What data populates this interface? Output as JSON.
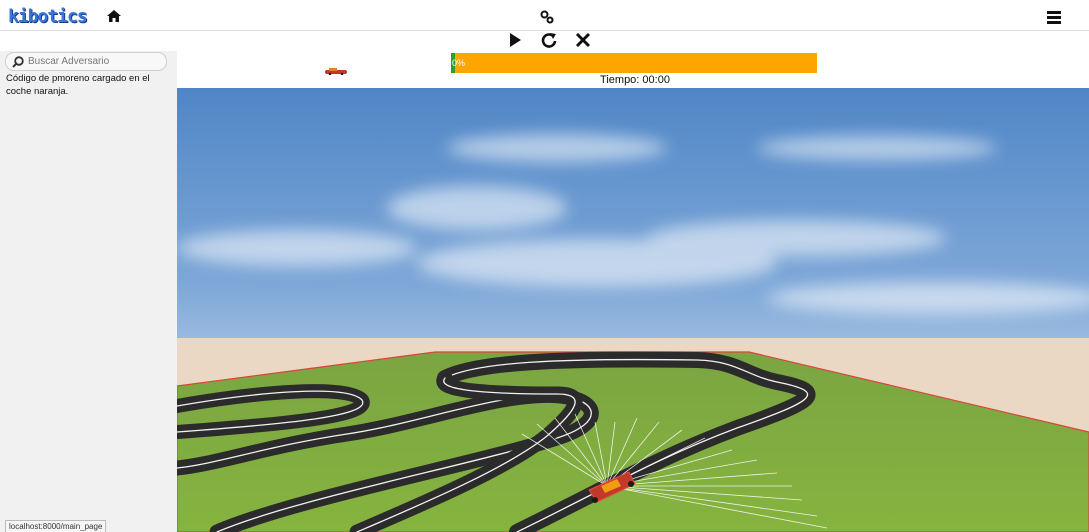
{
  "header": {
    "logo_text": "kibotics",
    "home_icon": "home-icon",
    "gears_icon": "gears-icon",
    "menu_icon": "hamburger-icon"
  },
  "toolbar": {
    "play_icon": "play-icon",
    "restart_icon": "restart-icon",
    "stop_icon": "close-icon"
  },
  "sidebar": {
    "search_placeholder": "Buscar Adversario",
    "message": "Código de pmoreno cargado en el coche naranja."
  },
  "race": {
    "progress_label": "0%",
    "progress_fraction": 0.0,
    "timer": "Tiempo: 00:00",
    "progress_color": "#ffa500",
    "start_color": "#2ca02c"
  },
  "status_bar": {
    "url": "localhost:8000/main_page"
  }
}
